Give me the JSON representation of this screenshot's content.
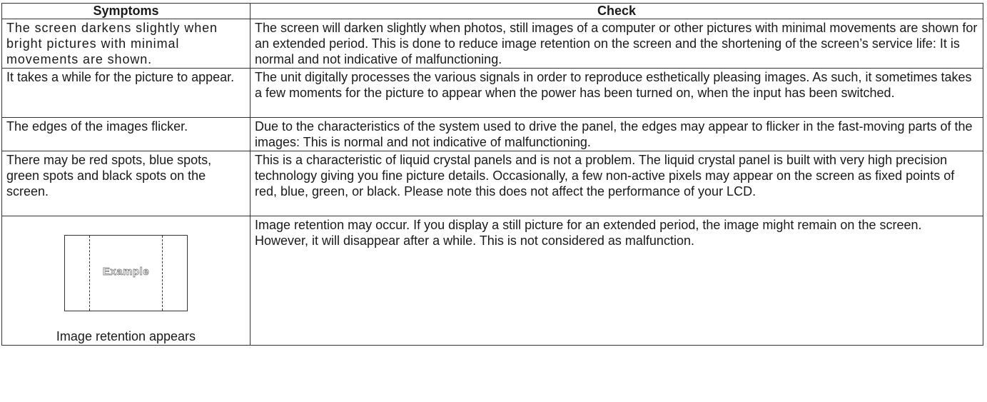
{
  "table": {
    "headers": {
      "symptoms": "Symptoms",
      "check": "Check"
    },
    "rows": [
      {
        "symptom": "The screen darkens slightly when bright pictures with minimal movements are shown.",
        "check": "The screen will darken slightly when photos, still images of a computer or other pictures with minimal movements are shown for an extended period. This is done to reduce image retention on the screen and the shortening of the screen’s service life: It is normal and not indicative of malfunctioning."
      },
      {
        "symptom": "It takes a while for the picture to appear.",
        "check": "The unit digitally processes the various signals in order to reproduce esthetically pleasing images. As such, it sometimes takes a few moments for the picture to appear when the power has been turned on, when the input has been switched."
      },
      {
        "symptom": "The edges of the images flicker.",
        "check": "Due to the characteristics of the system used to drive the panel, the edges may appear to flicker in the fast-moving parts of the images: This is normal and not indicative of malfunctioning."
      },
      {
        "symptom": "There may be red spots, blue spots, green spots and black spots on the screen.",
        "check": "This is a characteristic of liquid crystal panels and is not a problem. The liquid crystal panel is built with very high precision technology giving you fine picture details. Occasionally, a few non-active pixels may appear on the screen as fixed points of red, blue, green, or black. Please note this does not affect the performance of your LCD."
      },
      {
        "figure_label": "Example",
        "figure_caption": "Image retention appears",
        "check": "Image retention may occur. If you display a still picture for an extended period, the image might remain on the screen. However, it will disappear after a while. This is not considered as malfunction."
      }
    ]
  }
}
